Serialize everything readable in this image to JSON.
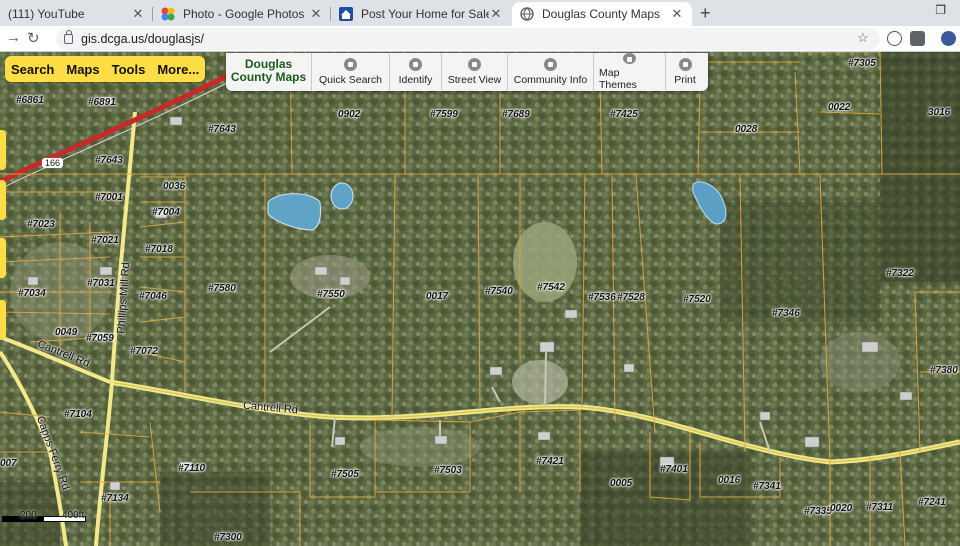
{
  "browser": {
    "tabs": [
      {
        "title": "(111) YouTube",
        "icon": "youtube-icon"
      },
      {
        "title": "Photo - Google Photos",
        "icon": "google-photos-icon"
      },
      {
        "title": "Post Your Home for Sale by Owne",
        "icon": "home-icon"
      },
      {
        "title": "Douglas County Maps",
        "icon": "globe-icon",
        "active": true
      }
    ],
    "new_tab": "+",
    "url": "gis.dcga.us/douglasjs/"
  },
  "map_menu": {
    "items": [
      "Search",
      "Maps",
      "Tools",
      "More..."
    ],
    "accent": "#ffdd44"
  },
  "map_toolbar": {
    "brand_line1": "Douglas",
    "brand_line2": "County Maps",
    "tools": [
      "Quick Search",
      "Identify",
      "Street View",
      "Community Info",
      "Map Themes",
      "Print"
    ]
  },
  "parcels": [
    "#6861",
    "#6891",
    "#7643",
    "#7643",
    "0902",
    "#7599",
    "#7689",
    "#7425",
    "0028",
    "0022",
    "#7305",
    "3016",
    "0036",
    "#7001",
    "#7004",
    "#7023",
    "#7021",
    "#7018",
    "#7031",
    "#7034",
    "#7046",
    "#7580",
    "#7550",
    "0017",
    "#7540",
    "#7542",
    "#7536",
    "#7528",
    "#7520",
    "#7346",
    "#7322",
    "0049",
    "#7059",
    "#7072",
    "#7380",
    "#7104",
    "007",
    "#7110",
    "#7134",
    "#7505",
    "#7503",
    "#7421",
    "0005",
    "#7401",
    "0016",
    "#7341",
    "#7335",
    "0020",
    "#7311",
    "#7241",
    "#7300"
  ],
  "roads": [
    "Cantrell Rd",
    "Cantrell Rd",
    "Phillips Mill Rd",
    "Capps Ferry Rd",
    "166"
  ],
  "scale": {
    "left": "200",
    "right": "400ft"
  }
}
